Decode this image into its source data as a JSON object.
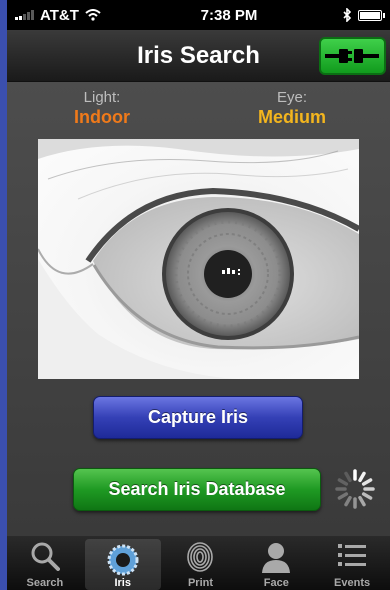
{
  "status_bar": {
    "carrier": "AT&T",
    "time": "7:38 PM",
    "icons": [
      "signal-icon",
      "wifi-icon",
      "bluetooth-icon",
      "battery-icon"
    ]
  },
  "nav": {
    "title": "Iris Search",
    "connect_icon": "plug-connector-icon",
    "connect_color": "#2bb536"
  },
  "info": {
    "light_label": "Light:",
    "light_value": "Indoor",
    "light_color": "#f07a1a",
    "eye_label": "Eye:",
    "eye_value": "Medium",
    "eye_color": "#f3b51e"
  },
  "buttons": {
    "capture_label": "Capture Iris",
    "search_label": "Search Iris Database"
  },
  "tabs": [
    {
      "label": "Search",
      "icon": "search-icon",
      "active": false
    },
    {
      "label": "Iris",
      "icon": "iris-icon",
      "active": true
    },
    {
      "label": "Print",
      "icon": "fingerprint-icon",
      "active": false
    },
    {
      "label": "Face",
      "icon": "face-icon",
      "active": false
    },
    {
      "label": "Events",
      "icon": "list-icon",
      "active": false
    }
  ]
}
